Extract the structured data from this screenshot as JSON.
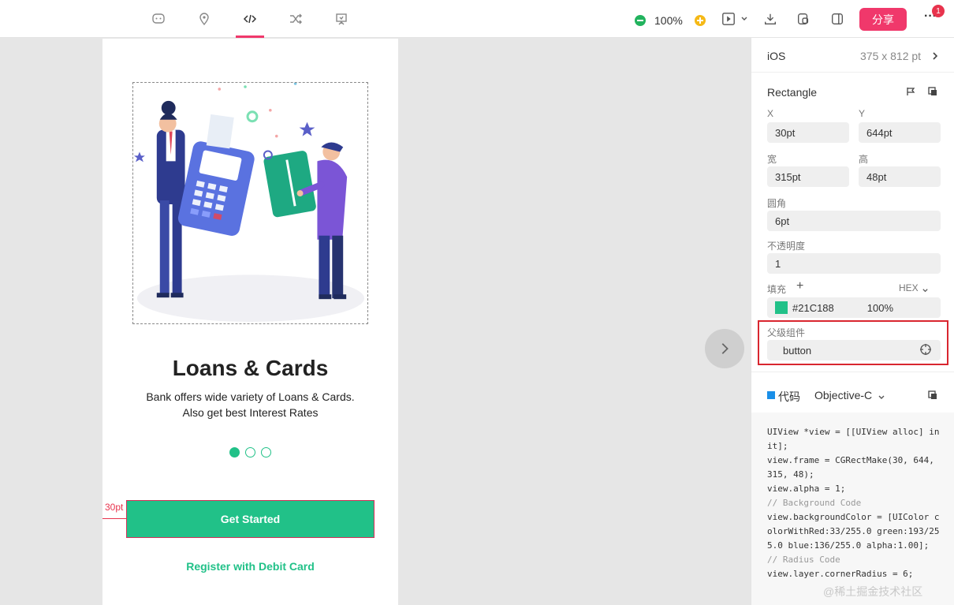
{
  "toolbar": {
    "tabs": [
      {
        "icon": "comment-icon"
      },
      {
        "icon": "location-icon"
      },
      {
        "icon": "code-icon",
        "active": true
      },
      {
        "icon": "shuffle-icon"
      },
      {
        "icon": "presentation-icon"
      }
    ],
    "zoom": "100%",
    "share_label": "分享",
    "more_label": "···",
    "notification_count": "1",
    "accent": "#f0386b"
  },
  "artboard": {
    "title": "Loans & Cards",
    "description_line1": "Bank offers wide variety of Loans & Cards.",
    "description_line2": "Also get best Interest Rates",
    "page_dots": {
      "count": 3,
      "active": 0
    },
    "primary_button": "Get Started",
    "secondary_link": "Register with Debit Card",
    "measure_label": "30pt",
    "brand_color": "#21C188"
  },
  "panel": {
    "device": "iOS",
    "device_size": "375 x 812 pt",
    "layer_name": "Rectangle",
    "x_label": "X",
    "x_value": "30pt",
    "y_label": "Y",
    "y_value": "644pt",
    "width_label": "宽",
    "width_value": "315pt",
    "height_label": "高",
    "height_value": "48pt",
    "radius_label": "圆角",
    "radius_value": "6pt",
    "opacity_label": "不透明度",
    "opacity_value": "1",
    "fill_label": "填充",
    "fill_format": "HEX",
    "fill_color": "#21C188",
    "fill_opacity": "100%",
    "parent_label": "父级组件",
    "parent_value": "button",
    "code_label": "代码",
    "code_language": "Objective-C"
  },
  "code_lines": [
    "UIView *view = [[UIView alloc] in",
    "it];",
    "view.frame = CGRectMake(30, 644,",
    "315, 48);",
    "view.alpha = 1;",
    "// Background Code",
    "view.backgroundColor = [UIColor c",
    "olorWithRed:33/255.0 green:193/25",
    "5.0 blue:136/255.0 alpha:1.00];",
    "// Radius Code",
    "view.layer.cornerRadius = 6;"
  ],
  "watermark": "@稀土掘金技术社区"
}
